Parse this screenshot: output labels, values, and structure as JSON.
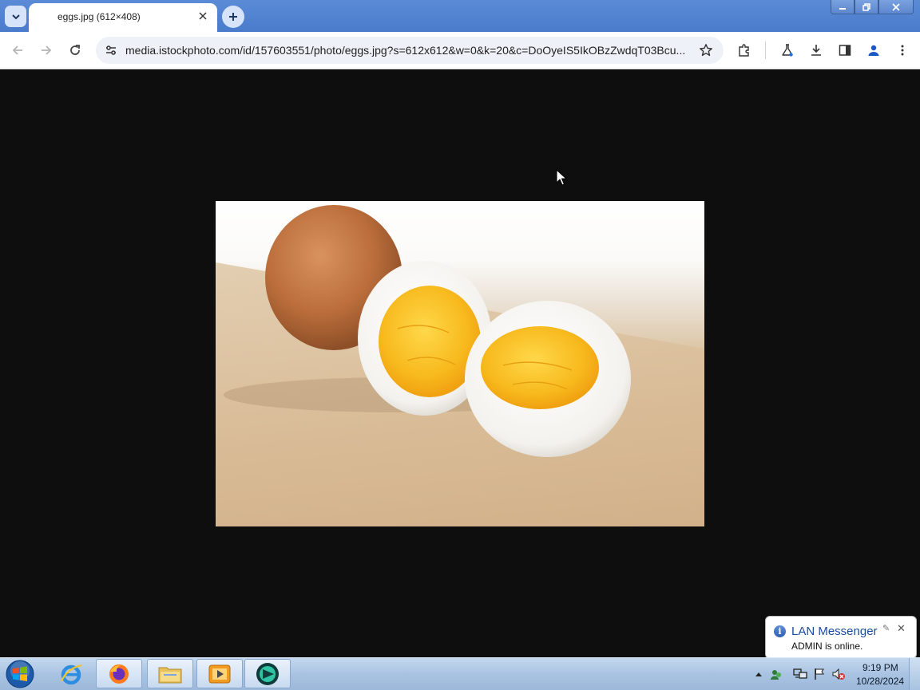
{
  "browser": {
    "tab": {
      "title": "eggs.jpg (612×408)"
    },
    "omnibox": {
      "url": "media.istockphoto.com/id/157603551/photo/eggs.jpg?s=612x612&w=0&k=20&c=DoOyeIS5IkOBzZwdqT03Bcu..."
    }
  },
  "notification": {
    "title": "LAN Messenger",
    "body": "ADMIN is online."
  },
  "taskbar": {
    "clock": {
      "time": "9:19 PM",
      "date": "10/28/2024"
    }
  },
  "colors": {
    "titlebar": "#4a7bcc",
    "content_bg": "#0e0e0e",
    "taskbar": "#a9c3e2",
    "notification_title": "#1a4b9b"
  }
}
